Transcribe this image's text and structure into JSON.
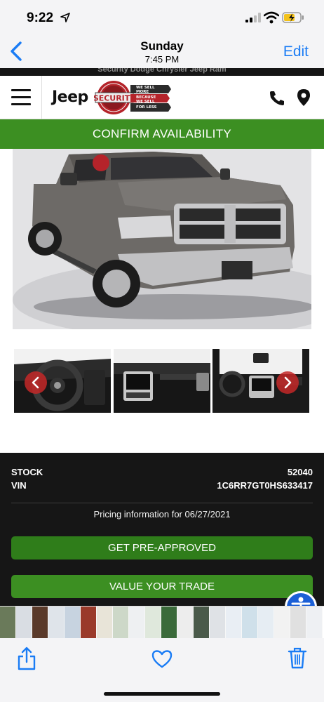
{
  "status_bar": {
    "time": "9:22"
  },
  "viewer": {
    "day": "Sunday",
    "time": "7:45 PM",
    "edit_label": "Edit"
  },
  "site": {
    "top_banner_partial": "Security Dodge Chrysler Jeep Ram",
    "brand": "Jeep",
    "dealer_logo_lines": [
      "WE SELL",
      "MORE",
      "BECAUSE",
      "WE SELL",
      "FOR LESS"
    ],
    "dealer_logo_word": "SECURITY",
    "confirm_label": "CONFIRM AVAILABILITY"
  },
  "vehicle": {
    "stock_label": "STOCK",
    "stock_value": "52040",
    "vin_label": "VIN",
    "vin_value": "1C6RR7GT0HS633417",
    "pricing_text": "Pricing information for 06/27/2021"
  },
  "actions": {
    "preapproved_label": "GET PRE-APPROVED",
    "trade_label": "VALUE YOUR TRADE"
  },
  "colors": {
    "ios_blue": "#1a7cf5",
    "site_green": "#3c8f22",
    "dark_section": "#161616",
    "arrow_red": "#c42828"
  },
  "icons": {
    "menu": "hamburger-icon",
    "phone": "phone-icon",
    "location": "map-pin-icon",
    "share": "share-icon",
    "favorite": "heart-icon",
    "delete": "trash-icon",
    "accessibility": "accessibility-icon"
  }
}
